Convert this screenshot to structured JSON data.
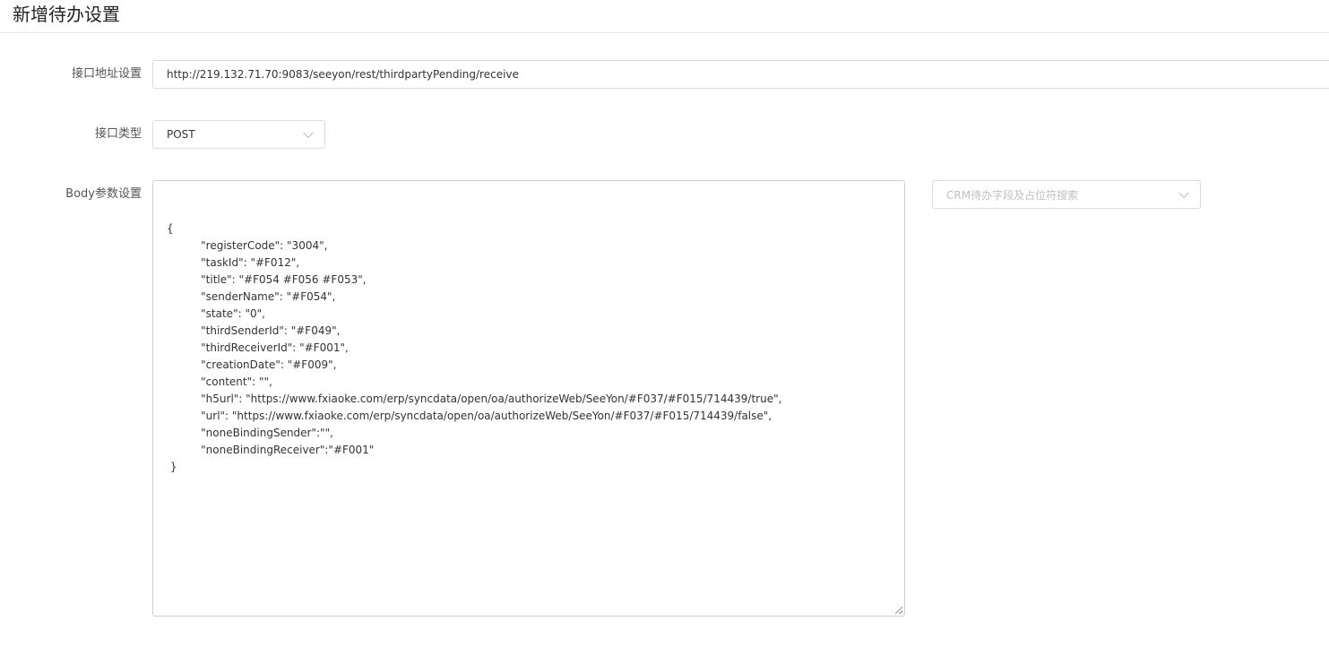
{
  "page": {
    "title": "新增待办设置"
  },
  "form": {
    "url": {
      "label": "接口地址设置",
      "value": "http://219.132.71.70:9083/seeyon/rest/thirdpartyPending/receive"
    },
    "method": {
      "label": "接口类型",
      "value": "POST"
    },
    "body": {
      "label": "Body参数设置",
      "value": "{\n          \"registerCode\": \"3004\",\n          \"taskId\": \"#F012\",\n          \"title\": \"#F054 #F056 #F053\",\n          \"senderName\": \"#F054\",\n          \"state\": \"0\",\n          \"thirdSenderId\": \"#F049\",\n          \"thirdReceiverId\": \"#F001\",\n          \"creationDate\": \"#F009\",\n          \"content\": \"\",\n          \"h5url\": \"https://www.fxiaoke.com/erp/syncdata/open/oa/authorizeWeb/SeeYon/#F037/#F015/714439/true\",\n          \"url\": \"https://www.fxiaoke.com/erp/syncdata/open/oa/authorizeWeb/SeeYon/#F037/#F015/714439/false\",\n          \"noneBindingSender\":\"\",\n          \"noneBindingReceiver\":\"#F001\"\n }"
    },
    "field_search": {
      "placeholder": "CRM待办字段及占位符搜索"
    }
  },
  "colors": {
    "border": "#dcdcdc",
    "placeholder": "#bfbfbf",
    "text": "#333333"
  },
  "icons": {
    "dropdown": "chevron-down-icon",
    "resize": "resize-grip-icon"
  }
}
